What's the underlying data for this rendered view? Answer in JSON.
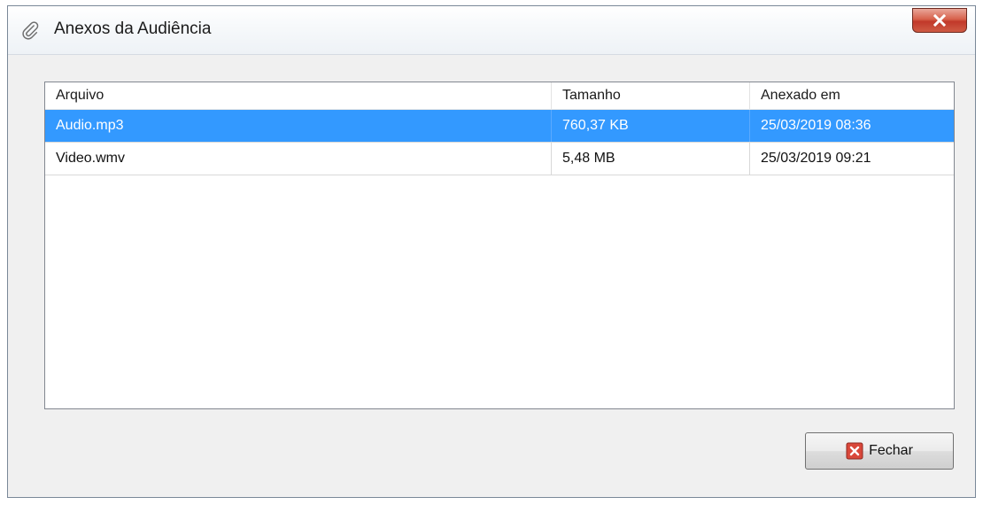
{
  "window": {
    "title": "Anexos da Audiência",
    "title_icon": "paperclip-icon",
    "close_icon": "close-icon"
  },
  "table": {
    "columns": [
      "Arquivo",
      "Tamanho",
      "Anexado em"
    ],
    "rows": [
      {
        "file": "Audio.mp3",
        "size": "760,37 KB",
        "date": "25/03/2019 08:36",
        "selected": true
      },
      {
        "file": "Video.wmv",
        "size": "5,48 MB",
        "date": "25/03/2019 09:21",
        "selected": false
      }
    ]
  },
  "footer": {
    "close_label": "Fechar",
    "close_icon": "red-x-icon"
  },
  "colors": {
    "selection": "#3399ff",
    "window_bg": "#f0f0f0",
    "close_red": "#c1392a"
  }
}
